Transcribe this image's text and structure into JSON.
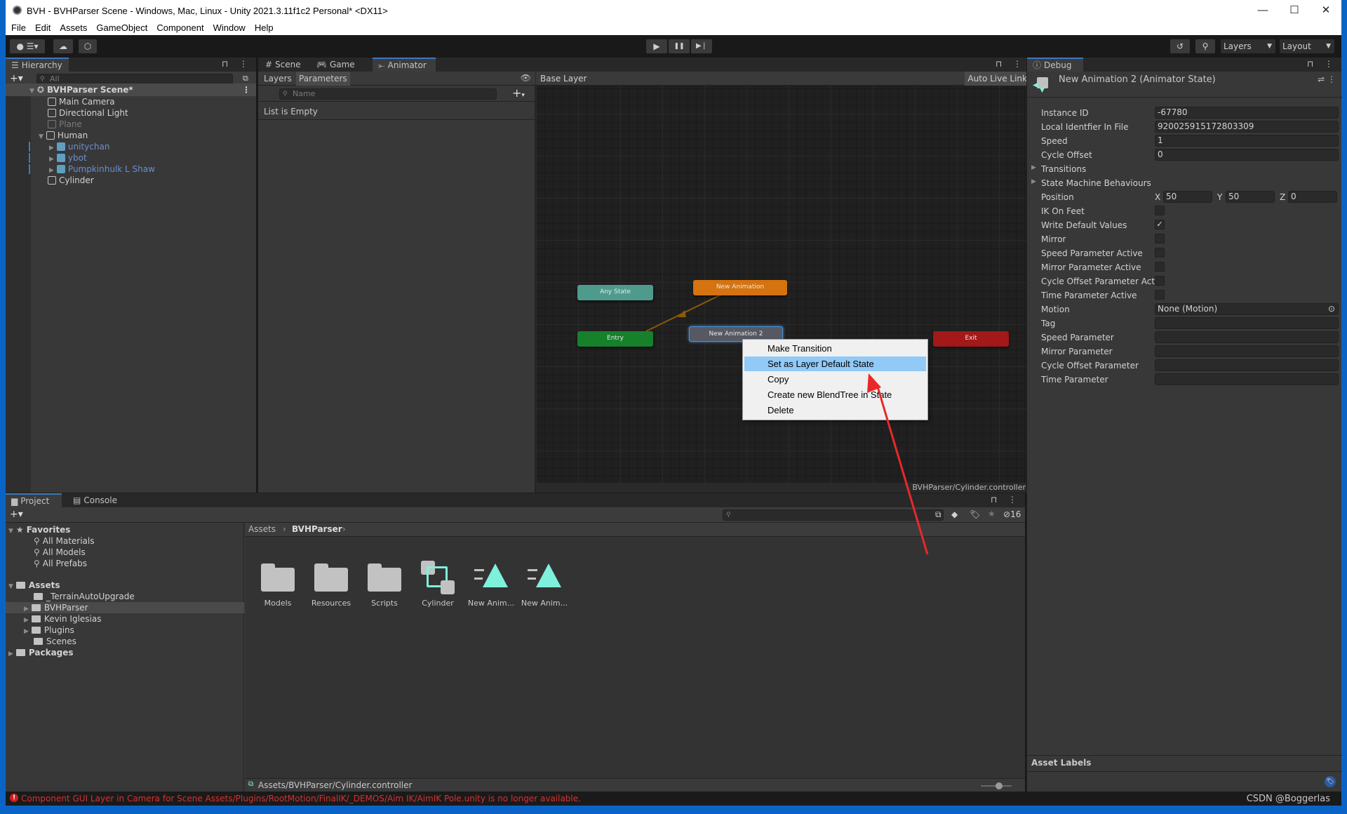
{
  "window": {
    "title": "BVH - BVHParser Scene - Windows, Mac, Linux - Unity 2021.3.11f1c2 Personal* <DX11>",
    "controls": {
      "minimize": "—",
      "maximize": "☐",
      "close": "✕"
    }
  },
  "menu": [
    "File",
    "Edit",
    "Assets",
    "GameObject",
    "Component",
    "Window",
    "Help"
  ],
  "toolbar": {
    "account_icon": "account-icon",
    "play": "▶",
    "pause": "❚❚",
    "step": "▶❘",
    "layers_dropdown": "Layers",
    "layout_dropdown": "Layout"
  },
  "hierarchy": {
    "tab": "Hierarchy",
    "search_placeholder": "All",
    "scene": "BVHParser Scene*",
    "items": [
      {
        "label": "Main Camera",
        "type": "gameobject",
        "state": "normal"
      },
      {
        "label": "Directional Light",
        "type": "gameobject",
        "state": "normal"
      },
      {
        "label": "Plane",
        "type": "gameobject",
        "state": "disabled"
      },
      {
        "label": "Human",
        "type": "gameobject",
        "state": "expanded"
      },
      {
        "label": "unitychan",
        "type": "prefab",
        "state": "collapsed"
      },
      {
        "label": "ybot",
        "type": "prefab",
        "state": "collapsed"
      },
      {
        "label": "Pumpkinhulk L Shaw",
        "type": "prefab",
        "state": "collapsed"
      },
      {
        "label": "Cylinder",
        "type": "gameobject",
        "state": "normal"
      }
    ]
  },
  "center_tabs": [
    "Scene",
    "Game",
    "Animator"
  ],
  "animator": {
    "subtabs": [
      "Layers",
      "Parameters"
    ],
    "param_search_placeholder": "Name",
    "list_empty": "List is Empty",
    "breadcrumb": "Base Layer",
    "auto_live_link": "Auto Live Link",
    "footer_path": "BVHParser/Cylinder.controller",
    "nodes": [
      {
        "label": "Any State",
        "color": "#4e9b8c"
      },
      {
        "label": "New Animation",
        "color": "#d4730f"
      },
      {
        "label": "Entry",
        "color": "#17802b"
      },
      {
        "label": "New Animation 2",
        "color": "#565963"
      },
      {
        "label": "Exit",
        "color": "#a31818"
      }
    ],
    "context_menu": [
      {
        "label": "Make Transition",
        "highlighted": false
      },
      {
        "label": "Set as Layer Default State",
        "highlighted": true
      },
      {
        "label": "Copy",
        "highlighted": false
      },
      {
        "label": "Create new BlendTree in State",
        "highlighted": false
      },
      {
        "label": "Delete",
        "highlighted": false
      }
    ]
  },
  "inspector": {
    "tab": "Debug",
    "title": "New Animation 2 (Animator State)",
    "fields": [
      {
        "label": "Instance ID",
        "value": "-67780",
        "kind": "text"
      },
      {
        "label": "Local Identfier In File",
        "value": "9200259151728033​09",
        "kind": "text"
      },
      {
        "label": "Speed",
        "value": "1",
        "kind": "text"
      },
      {
        "label": "Cycle Offset",
        "value": "0",
        "kind": "text"
      },
      {
        "label": "Transitions",
        "kind": "foldout"
      },
      {
        "label": "State Machine Behaviours",
        "kind": "foldout"
      },
      {
        "label": "Position",
        "kind": "vector3",
        "x": "50",
        "y": "50",
        "z": "0"
      },
      {
        "label": "IK On Feet",
        "kind": "check",
        "checked": false
      },
      {
        "label": "Write Default Values",
        "kind": "check",
        "checked": true
      },
      {
        "label": "Mirror",
        "kind": "check",
        "checked": false
      },
      {
        "label": "Speed Parameter Active",
        "kind": "check",
        "checked": false
      },
      {
        "label": "Mirror Parameter Active",
        "kind": "check",
        "checked": false
      },
      {
        "label": "Cycle Offset Parameter Activ",
        "kind": "check",
        "checked": false
      },
      {
        "label": "Time Parameter Active",
        "kind": "check",
        "checked": false
      },
      {
        "label": "Motion",
        "value": "None (Motion)",
        "kind": "object"
      },
      {
        "label": "Tag",
        "value": "",
        "kind": "text"
      },
      {
        "label": "Speed Parameter",
        "value": "",
        "kind": "text"
      },
      {
        "label": "Mirror Parameter",
        "value": "",
        "kind": "text"
      },
      {
        "label": "Cycle Offset Parameter",
        "value": "",
        "kind": "text"
      },
      {
        "label": "Time Parameter",
        "value": "",
        "kind": "text"
      }
    ],
    "asset_labels": "Asset Labels"
  },
  "project": {
    "tabs": [
      "Project",
      "Console"
    ],
    "hidden_count": "16",
    "favorites": {
      "label": "Favorites",
      "items": [
        "All Materials",
        "All Models",
        "All Prefabs"
      ]
    },
    "assets": {
      "label": "Assets",
      "items": [
        {
          "label": "_TerrainAutoUpgrade",
          "expandable": false,
          "selected": false
        },
        {
          "label": "BVHParser",
          "expandable": true,
          "selected": true
        },
        {
          "label": "Kevin Iglesias",
          "expandable": true,
          "selected": false
        },
        {
          "label": "Plugins",
          "expandable": true,
          "selected": false
        },
        {
          "label": "Scenes",
          "expandable": false,
          "selected": false
        }
      ]
    },
    "packages": "Packages",
    "breadcrumb": [
      "Assets",
      "BVHParser"
    ],
    "grid": [
      {
        "label": "Models",
        "type": "folder"
      },
      {
        "label": "Resources",
        "type": "folder"
      },
      {
        "label": "Scripts",
        "type": "folder"
      },
      {
        "label": "Cylinder",
        "type": "controller"
      },
      {
        "label": "New Anim...",
        "type": "animation"
      },
      {
        "label": "New Anim...",
        "type": "animation"
      }
    ],
    "footer_path": "Assets/BVHParser/Cylinder.controller",
    "zoom_slider": 0.6
  },
  "status": {
    "error": "Component GUI Layer in Camera for Scene Assets/Plugins/RootMotion/FinalIK/_DEMOS/Aim IK/AimIK Pole.unity is no longer available.",
    "watermark": "CSDN @Boggerlas"
  }
}
